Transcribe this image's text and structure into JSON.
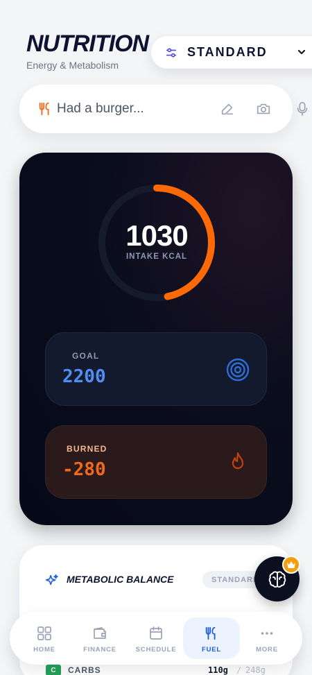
{
  "header": {
    "title": "NUTRITION",
    "subtitle": "Energy & Metabolism",
    "mode_select": {
      "value": "STANDARD",
      "icon": "sliders-icon",
      "chevron": "chevron-down-icon"
    }
  },
  "input_bar": {
    "icon": "fork-knife-icon",
    "placeholder": "Had a burger...",
    "actions": [
      "pencil-icon",
      "camera-icon",
      "microphone-icon"
    ]
  },
  "intake_card": {
    "ring": {
      "value": "1030",
      "label": "INTAKE KCAL",
      "progress": 0.4682
    },
    "goal": {
      "label": "GOAL",
      "value": "2200",
      "icon": "target-icon"
    },
    "burned": {
      "label": "BURNED",
      "value": "-280",
      "icon": "flame-icon"
    }
  },
  "metabolic_balance": {
    "icon": "sparkles-icon",
    "title": "METABOLIC BALANCE",
    "badge": "STANDARD",
    "macros": [
      {
        "letter": "C",
        "name": "CARBS",
        "amount": "110g",
        "separator": "/",
        "goal": "248g"
      }
    ]
  },
  "assistant_fab": {
    "icon": "brain-icon",
    "badge_icon": "crown-icon"
  },
  "nav": {
    "items": [
      {
        "label": "HOME",
        "icon": "grid-icon",
        "active": false
      },
      {
        "label": "FINANCE",
        "icon": "wallet-icon",
        "active": false
      },
      {
        "label": "SCHEDULE",
        "icon": "calendar-icon",
        "active": false
      },
      {
        "label": "FUEL",
        "icon": "fork-knife-icon",
        "active": true
      },
      {
        "label": "MORE",
        "icon": "dots-icon",
        "active": false
      }
    ]
  },
  "colors": {
    "accent_orange": "#f16a1a",
    "goal_blue": "#4f8ff2",
    "active_blue": "#1d5fe0",
    "dark_card": "#060918"
  }
}
